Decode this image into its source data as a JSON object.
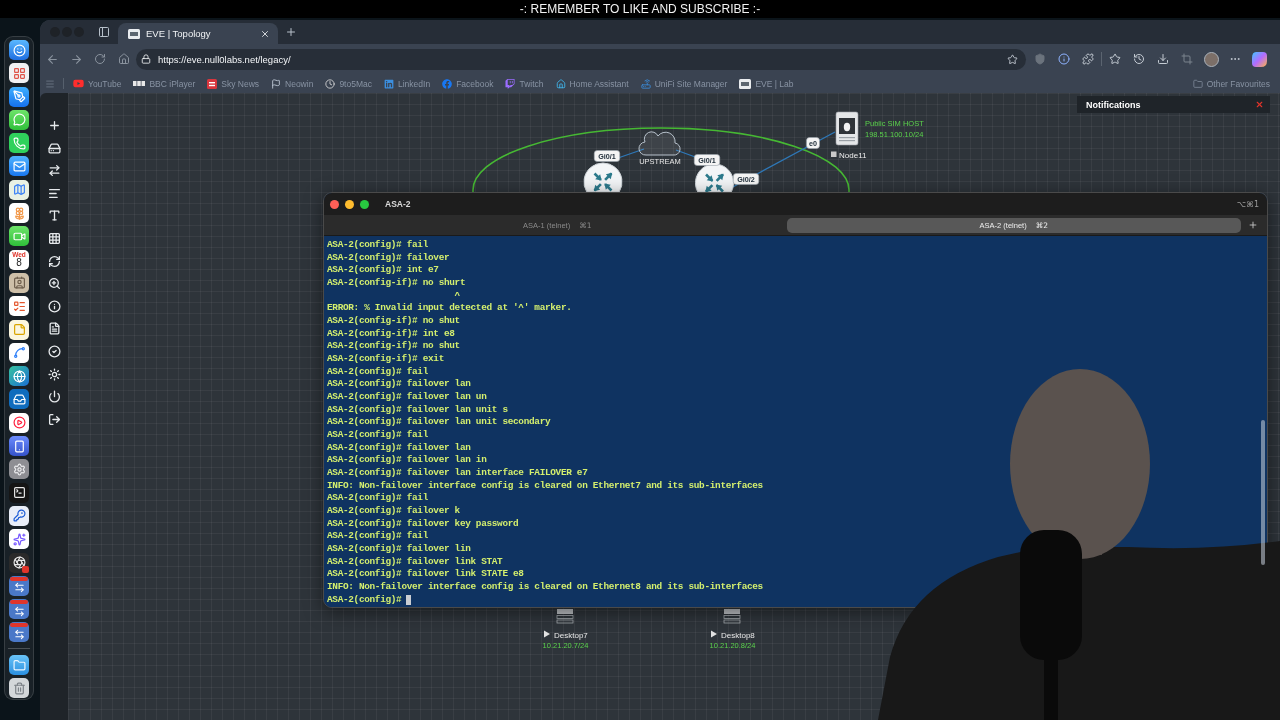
{
  "banner": {
    "text": "-: REMEMBER TO LIKE AND SUBSCRIBE :-"
  },
  "dock": {
    "calendar": {
      "weekday": "Wed",
      "day": "8"
    }
  },
  "browser": {
    "tabs": [
      {
        "title": "EVE | Topology",
        "selected": true
      }
    ],
    "url": "https://eve.null0labs.net/legacy/",
    "bookmarks": [
      "YouTube",
      "BBC iPlayer",
      "Sky News",
      "Neowin",
      "9to5Mac",
      "LinkedIn",
      "Facebook",
      "Twitch",
      "Home Assistant",
      "UniFi Site Manager",
      "EVE | Lab"
    ],
    "other_bookmarks": "Other Favourites"
  },
  "topology": {
    "cloud": {
      "label": "UPSTREAM"
    },
    "routers": [
      {
        "ports": [
          "Gi0/1"
        ]
      },
      {
        "ports": [
          "Gi0/1",
          "Gi0/2"
        ]
      }
    ],
    "host": {
      "name": "Node11",
      "running": false,
      "port": "e0",
      "description": "Public SIM HOST",
      "address": "198.51.100.10/24"
    },
    "desktops": [
      {
        "name": "Desktop7",
        "running": true,
        "address": "10.21.20.7/24"
      },
      {
        "name": "Desktop8",
        "running": true,
        "address": "10.21.20.8/24"
      }
    ]
  },
  "notifications": {
    "title": "Notifications"
  },
  "terminal": {
    "title": "ASA-2",
    "shortcut": "⌥⌘1",
    "tabs": [
      {
        "label": "ASA-1 (telnet)",
        "shortcut": "⌘1",
        "selected": false
      },
      {
        "label": "ASA-2 (telnet)",
        "shortcut": "⌘2",
        "selected": true
      }
    ],
    "lines": [
      "ASA-2(config)# fail",
      "ASA-2(config)# failover",
      "ASA-2(config)# int e7",
      "ASA-2(config-if)# no shurt",
      "                        ^",
      "ERROR: % Invalid input detected at '^' marker.",
      "ASA-2(config-if)# no shut",
      "ASA-2(config-if)# int e8",
      "ASA-2(config-if)# no shut",
      "ASA-2(config-if)# exit",
      "ASA-2(config)# fail",
      "ASA-2(config)# failover lan",
      "ASA-2(config)# failover lan un",
      "ASA-2(config)# failover lan unit s",
      "ASA-2(config)# failover lan unit secondary",
      "ASA-2(config)# fail",
      "ASA-2(config)# failover lan",
      "ASA-2(config)# failover lan in",
      "ASA-2(config)# failover lan interface FAILOVER e7",
      "INFO: Non-failover interface config is cleared on Ethernet7 and its sub-interfaces",
      "ASA-2(config)# fail",
      "ASA-2(config)# failover k",
      "ASA-2(config)# failover key password",
      "ASA-2(config)# fail",
      "ASA-2(config)# failover lin",
      "ASA-2(config)# failover link STAT",
      "ASA-2(config)# failover link STATE e8",
      "INFO: Non-failover interface config is cleared on Ethernet8 and its sub-interfaces",
      "ASA-2(config)#"
    ],
    "cursor": true
  }
}
